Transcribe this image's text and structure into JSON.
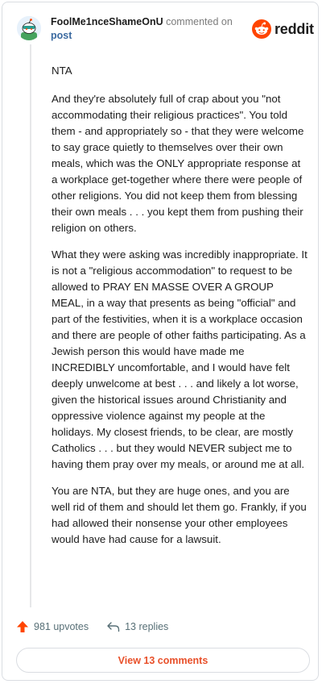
{
  "header": {
    "username": "FoolMe1nceShameOnU",
    "action_text": "commented on",
    "post_link": "post",
    "brand_name": "reddit",
    "avatar_icon": "snoo-avatar-icon",
    "brand_icon": "reddit-logo-icon"
  },
  "comment": {
    "paragraphs": [
      "NTA",
      "And they're absolutely full of crap about you \"not accommodating their religious practices\". You told them - and appropriately so - that they were welcome to say grace quietly to themselves over their own meals, which was the ONLY appropriate response at a workplace get-together where there were people of other religions. You did not keep them from blessing their own meals . . . you kept them from pushing their religion on others.",
      "What they were asking was incredibly inappropriate. It is not a \"religious accommodation\" to request to be allowed to PRAY EN MASSE OVER A GROUP MEAL, in a way that presents as being \"official\" and part of the festivities, when it is a workplace occasion and there are people of other faiths participating. As a Jewish person this would have made me INCREDIBLY uncomfortable, and I would have felt deeply unwelcome at best . . . and likely a lot worse, given the historical issues around Christianity and oppressive violence against my people at the holidays. My closest friends, to be clear, are mostly Catholics . . . but they would NEVER subject me to having them pray over my meals, or around me at all.",
      "You are NTA, but they are huge ones, and you are well rid of them and should let them go. Frankly, if you had allowed their nonsense your other employees would have had cause for a lawsuit."
    ]
  },
  "stats": {
    "upvotes": "981 upvotes",
    "replies": "13 replies",
    "upvote_icon": "upvote-arrow-icon",
    "reply_icon": "reply-arrow-icon"
  },
  "footer": {
    "view_comments": "View 13 comments"
  },
  "colors": {
    "accent": "#ff4500",
    "link": "#3b6aa0",
    "button_text": "#e8502a",
    "meta_text": "#576f76"
  }
}
